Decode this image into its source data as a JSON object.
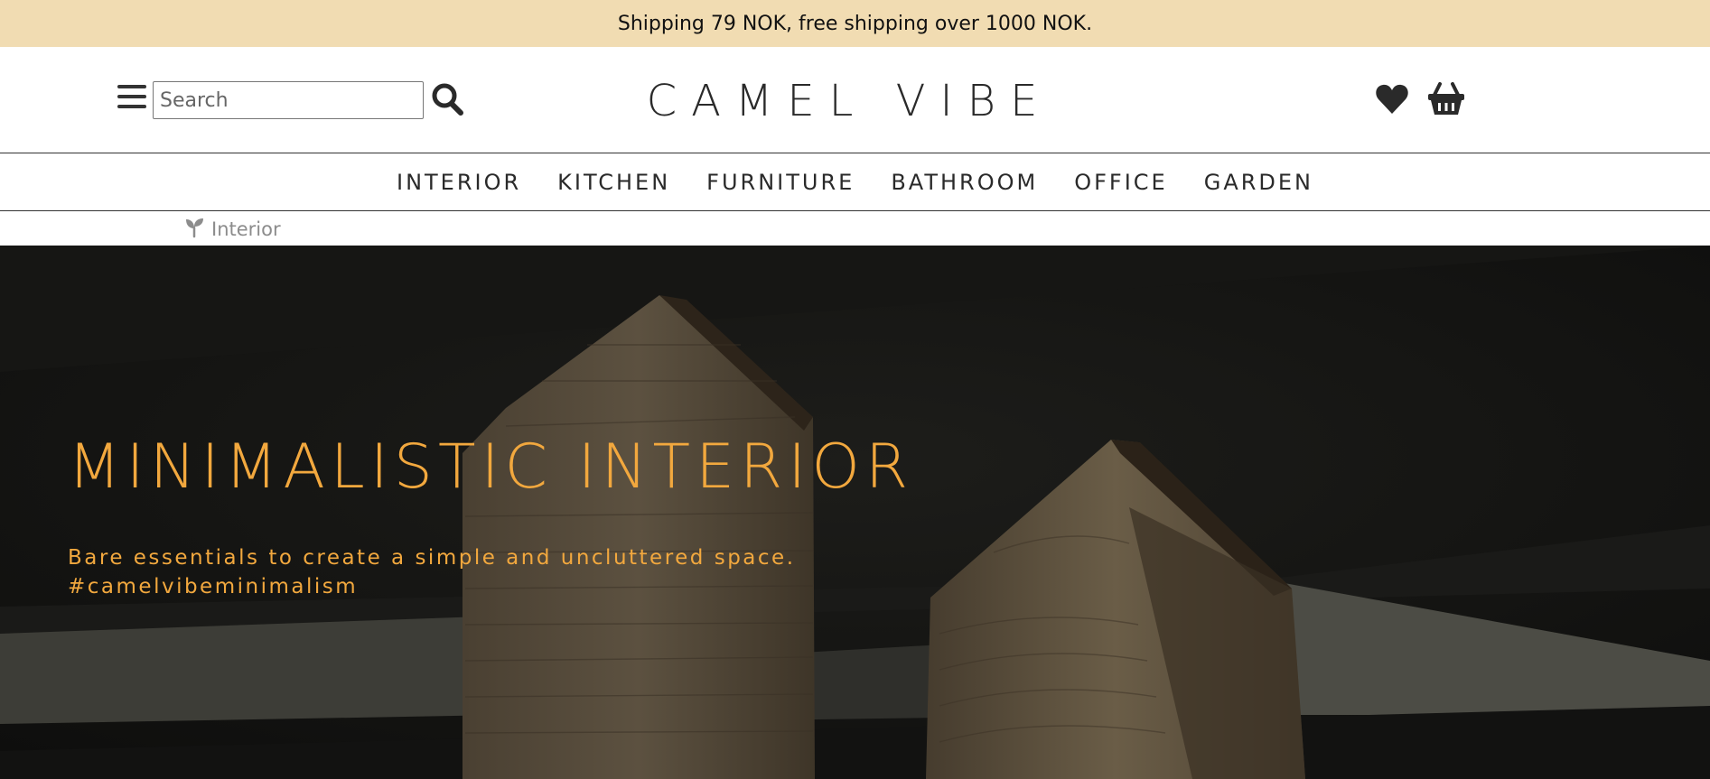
{
  "promo": {
    "text": "Shipping 79 NOK, free shipping over 1000 NOK."
  },
  "header": {
    "menu_icon": "hamburger-icon",
    "search": {
      "placeholder": "Search",
      "value": "",
      "icon": "search-icon"
    },
    "brand": "CAMEL VIBE",
    "wishlist_icon": "heart-icon",
    "cart_icon": "basket-icon"
  },
  "nav": {
    "items": [
      {
        "label": "INTERIOR"
      },
      {
        "label": "KITCHEN"
      },
      {
        "label": "FURNITURE"
      },
      {
        "label": "BATHROOM"
      },
      {
        "label": "OFFICE"
      },
      {
        "label": "GARDEN"
      }
    ]
  },
  "breadcrumb": {
    "icon": "seedling-icon",
    "label": "Interior"
  },
  "hero": {
    "title": "MINIMALISTIC INTERIOR",
    "subtitle_line1": "Bare essentials to create a simple and uncluttered space.",
    "subtitle_line2": "#camelvibeminimalism"
  },
  "colors": {
    "promo_bg": "#f1dcb2",
    "hero_text": "#f2a83e",
    "hero_bg": "#141412",
    "text_dark": "#2a2a2a",
    "muted": "#8c8c8c"
  }
}
